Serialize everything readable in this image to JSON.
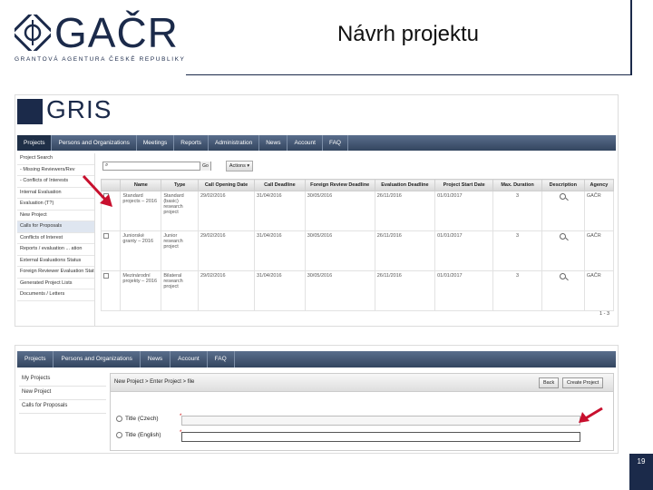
{
  "header": {
    "logo_text": "GAČR",
    "logo_tagline": "GRANTOVÁ AGENTURA ČESKÉ REPUBLIKY",
    "slide_title": "Návrh projektu"
  },
  "gris1": {
    "logo_text": "GRIS",
    "nav": [
      "Projects",
      "Persons and Organizations",
      "Meetings",
      "Reports",
      "Administration",
      "News",
      "Account",
      "FAQ"
    ],
    "sidebar": [
      "Project Search",
      "- Missing Reviewers/Rev",
      "- Conflicts of Interests",
      "Internal Evaluation",
      "Evaluation (T?)",
      "New Project",
      "Calls for Proposals",
      "Conflicts of Interest",
      "Reports / evaluation ... ation",
      "External Evaluations Status",
      "Foreign Reviewer Evaluation Status",
      "Generated Project Lists",
      "Documents / Letters"
    ],
    "search_placeholder": "",
    "search_go": "Go",
    "actions_label": "Actions ▾",
    "columns": [
      "",
      "Name",
      "Type",
      "Call Opening Date",
      "Call Deadline",
      "Foreign Review Deadline",
      "Evaluation Deadline",
      "Project Start Date",
      "Max. Duration",
      "Description",
      "Agency"
    ],
    "rows": [
      [
        "",
        "Standard projects – 2016",
        "Standard (basic) research project",
        "29/02/2016",
        "31/04/2016",
        "30/05/2016",
        "26/11/2016",
        "01/01/2017",
        "3",
        "",
        "GAČR"
      ],
      [
        "",
        "Juniorské granty – 2016",
        "Junior research project",
        "29/02/2016",
        "31/04/2016",
        "30/05/2016",
        "26/11/2016",
        "01/01/2017",
        "3",
        "",
        "GAČR"
      ],
      [
        "",
        "Mezinárodní projekty – 2016",
        "Bilateral research project",
        "29/02/2016",
        "31/04/2016",
        "30/05/2016",
        "26/11/2016",
        "01/01/2017",
        "3",
        "",
        "GAČR"
      ]
    ],
    "pager": "1 - 3"
  },
  "gris2": {
    "nav": [
      "Projects",
      "Persons and Organizations",
      "News",
      "Account",
      "FAQ"
    ],
    "sidebar": [
      "My Projects",
      "New Project",
      "Calls for Proposals"
    ],
    "breadcrumb": "New Project > Enter Project > file",
    "back_button": "Back",
    "create_button": "Create Project",
    "field_title_cz": "Title (Czech)",
    "field_title_en": "Title (English)",
    "required_mark": "*"
  },
  "page_number": "19",
  "colors": {
    "navy": "#1b2a4a",
    "arrow_red": "#c8102e"
  },
  "icons": [
    "gacr-emblem-icon",
    "gris-mark-icon",
    "magnifier-icon",
    "info-icon",
    "red-arrow-icon"
  ]
}
